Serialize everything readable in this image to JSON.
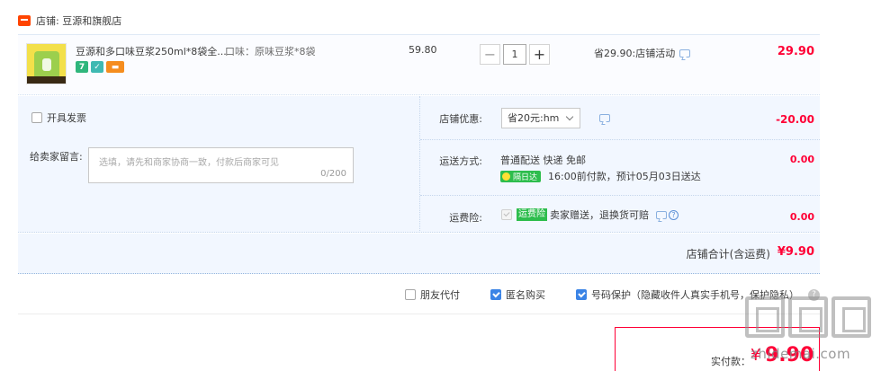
{
  "store": {
    "label": "店铺: 豆源和旗舰店"
  },
  "item": {
    "title": "豆源和多口味豆浆250ml*8袋全...",
    "attr": "口味：原味豆浆*8袋",
    "unit_price": "59.80",
    "quantity": "1",
    "minus_label": "−",
    "plus_label": "+",
    "badge_seven": "7",
    "promo": "省29.90:店铺活动",
    "total": "29.90"
  },
  "invoice": {
    "label": "开具发票"
  },
  "message": {
    "label": "给卖家留言:",
    "placeholder": "选填，请先和商家协商一致，付款后商家可见",
    "count": "0/200"
  },
  "coupon": {
    "label": "店铺优惠:",
    "selected": "省20元:hm",
    "value": "-20.00"
  },
  "shipping": {
    "label": "运送方式:",
    "main": "普通配送 快递 免邮",
    "badge": "隔日达",
    "sub": "16:00前付款，预计05月03日送达",
    "value": "0.00"
  },
  "insurance": {
    "label": "运费险:",
    "tag": "运费险",
    "text": "卖家赠送，退换货可赔",
    "help": "?",
    "value": "0.00"
  },
  "store_total": {
    "label": "店铺合计(含运费)",
    "value": "¥9.90"
  },
  "bottom_options": {
    "friend_pay": "朋友代付",
    "anonymous": "匿名购买",
    "privacy": "号码保护（隐藏收件人真实手机号，保护隐私）",
    "info": "?"
  },
  "payment": {
    "label": "实付款：",
    "currency": "¥",
    "value": "9.90"
  },
  "watermark": {
    "text": "zhidemai.com"
  },
  "colors": {
    "accent_red": "#ff0036",
    "blue": "#3b84e6",
    "green": "#2dbd4d",
    "panel_bg": "#f2f7ff"
  }
}
